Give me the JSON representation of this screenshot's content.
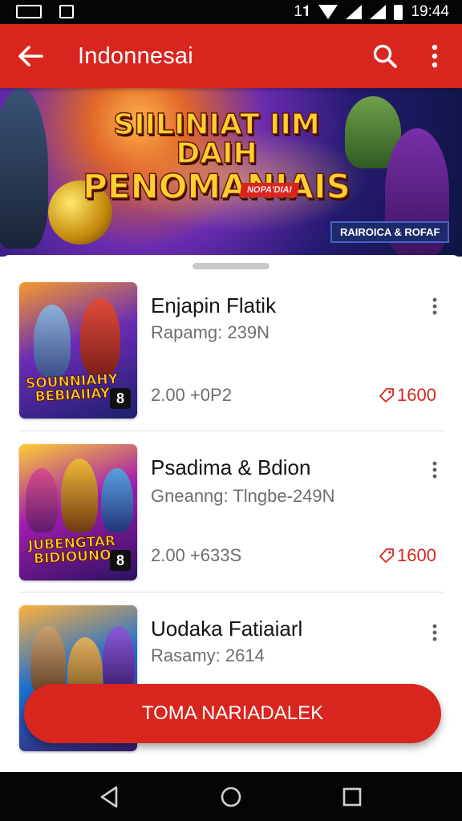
{
  "status_bar": {
    "time": "19:44",
    "carrier_glyph": "1𝟏",
    "icons": [
      "gallery-icon",
      "notification-icon",
      "wifi-icon",
      "signal-icon",
      "battery-icon"
    ]
  },
  "app_bar": {
    "title": "Indonnesai",
    "back_icon": "arrow-left-icon",
    "search_icon": "search-icon",
    "overflow_icon": "more-vertical-icon"
  },
  "banner": {
    "title_line1": "SIILINIAT IIM DAIH",
    "title_line2": "PENOMANIAIS",
    "tag": "NOPA'DIAI",
    "badge": "RAIROICA & ROFAF"
  },
  "games": [
    {
      "title": "Enjapin Flatik",
      "subtitle": "Rapamg: 239N",
      "meta": "2.00 +0P2",
      "price": "1600",
      "thumb_logo": "SOUNNIAHY BEBIAIIAY",
      "thumb_badge": "8",
      "colors": [
        "#f59a2c",
        "#6a2bb5",
        "#1c1f6e"
      ]
    },
    {
      "title": "Psadima & Bdion",
      "subtitle": "Gneanng: Tlngbe-249N",
      "meta": "2.00 +633S",
      "price": "1600",
      "thumb_logo": "JUBENGTAR BIDIOUNO",
      "thumb_badge": "8",
      "colors": [
        "#ffcc33",
        "#a21caf",
        "#2b1160"
      ]
    },
    {
      "title": "Uodaka Fatiaiarl",
      "subtitle": "Rasamy: 2614",
      "meta": "",
      "price": "",
      "thumb_logo": "",
      "thumb_badge": "",
      "colors": [
        "#ffb13b",
        "#1d6fd0",
        "#3a1a6b"
      ]
    }
  ],
  "cta": {
    "label": "TOMA NARIADALEK"
  },
  "accent_color": "#d8261f"
}
